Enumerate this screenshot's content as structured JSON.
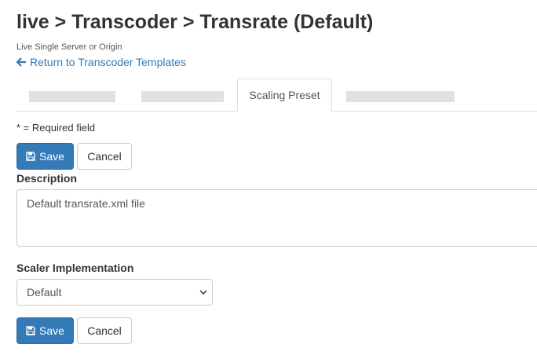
{
  "header": {
    "title": "live > Transcoder > Transrate (Default)",
    "subtitle": "Live Single Server or Origin",
    "back_link": "Return to Transcoder Templates"
  },
  "tabs": {
    "active_label": "Scaling Preset"
  },
  "form": {
    "required_note": "* = Required field",
    "save_label": "Save",
    "cancel_label": "Cancel",
    "description_label": "Description",
    "description_value": "Default transrate.xml file",
    "scaler_label": "Scaler Implementation",
    "scaler_value": "Default"
  },
  "colors": {
    "primary": "#337ab7",
    "link": "#337ab7"
  },
  "icons": [
    "arrow-left-icon",
    "floppy-disk-icon",
    "chevron-down-icon"
  ]
}
